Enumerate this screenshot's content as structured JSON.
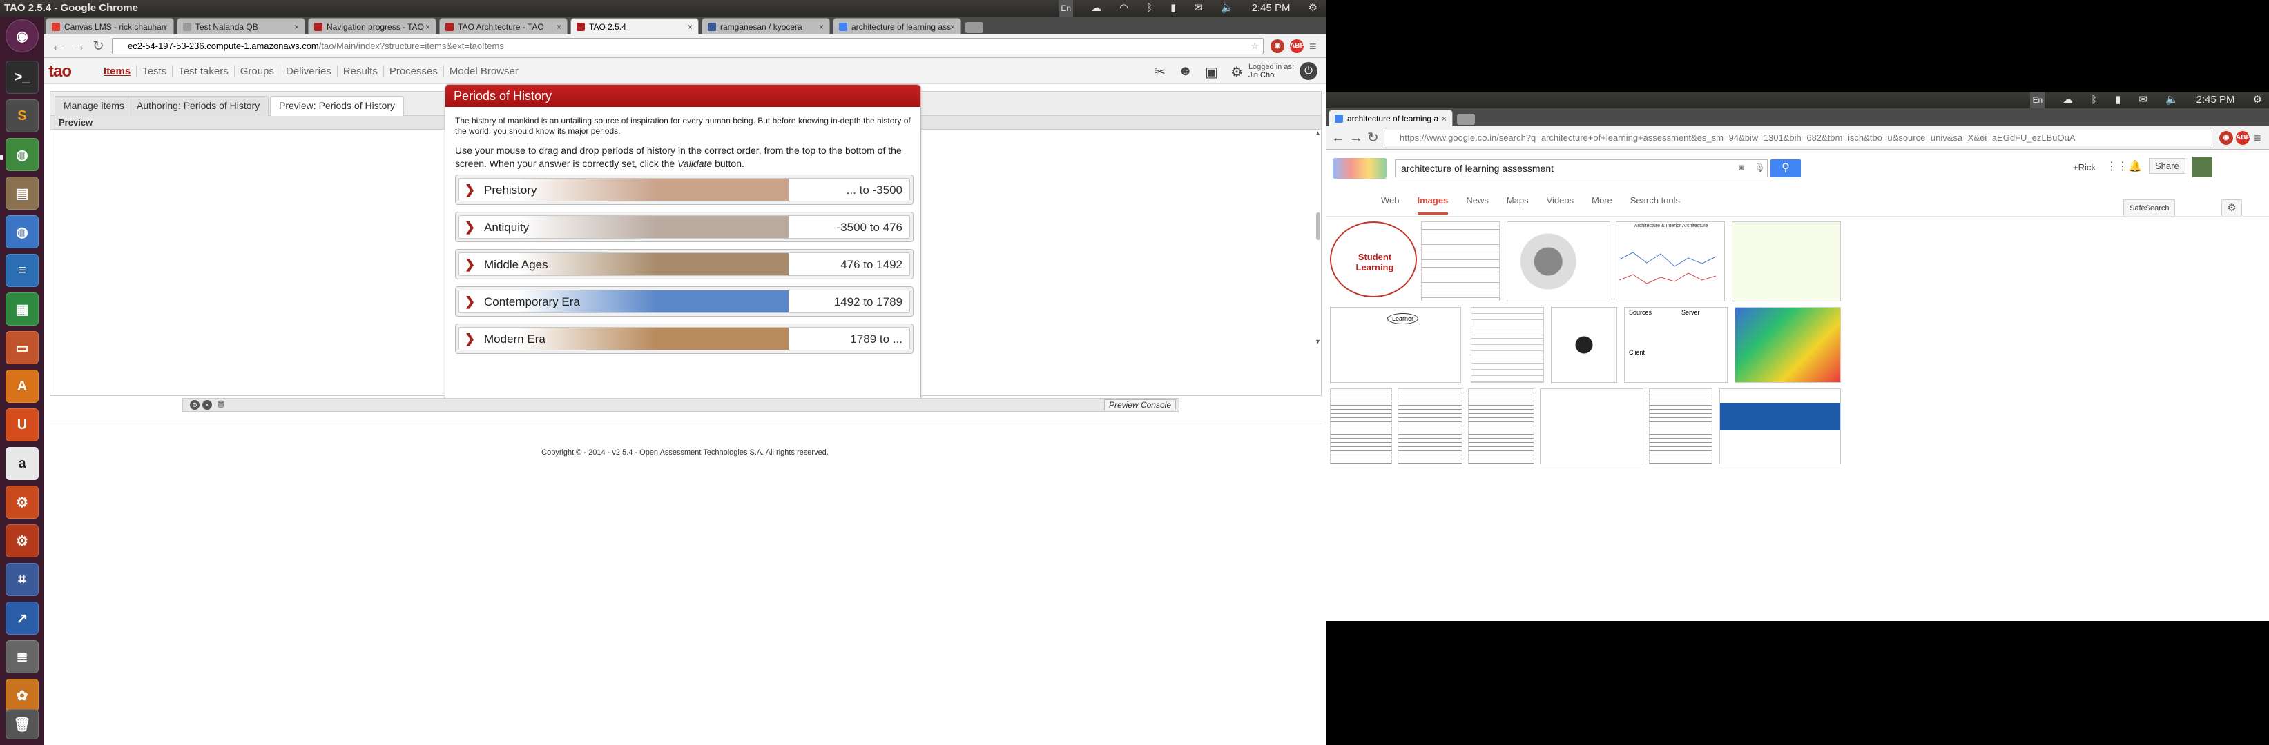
{
  "os": {
    "window_title": "TAO 2.5.4 - Google Chrome",
    "clock": "2:45 PM",
    "keyboard": "En",
    "launcher_icons": [
      "terminal-icon",
      "sublime-icon",
      "chrome-icon",
      "files-icon",
      "chromium-icon",
      "writer-icon",
      "calc-icon",
      "impress-icon",
      "software-center-icon",
      "ubuntu-one-icon",
      "amazon-icon",
      "settings-icon",
      "system-monitor-icon",
      "workspace-icon",
      "disk-icon",
      "photo-icon",
      "trash-icon"
    ]
  },
  "browser_left": {
    "tabs": [
      {
        "label": "Canvas LMS - rick.chauhan",
        "color": "#e33b2e"
      },
      {
        "label": "Test Nalanda QB",
        "color": "#999"
      },
      {
        "label": "Navigation progress - TAO",
        "color": "#b01e1e"
      },
      {
        "label": "TAO Architecture - TAO",
        "color": "#b01e1e"
      },
      {
        "label": "TAO 2.5.4",
        "color": "#b01e1e"
      },
      {
        "label": "ramganesan / kyocera",
        "color": "#3b5a99"
      },
      {
        "label": "architecture of learning ass",
        "color": "#4285f4"
      }
    ],
    "active_tab": 4,
    "url_host": "ec2-54-197-53-236.compute-1.amazonaws.com",
    "url_path": "/tao/Main/index?structure=items&ext=taoItems"
  },
  "tao": {
    "logo": "tao",
    "nav": [
      "Items",
      "Tests",
      "Test takers",
      "Groups",
      "Deliveries",
      "Results",
      "Processes",
      "Model Browser"
    ],
    "logged_in_label": "Logged in as:",
    "user": "Jin Choi",
    "tabs": [
      "Manage items",
      "Authoring: Periods of History",
      "Preview: Periods of History"
    ],
    "preview_label": "Preview",
    "console_label": "Preview Console",
    "footer": "Copyright © - 2014 - v2.5.4 - Open Assessment Technologies S.A. All rights reserved."
  },
  "item": {
    "title": "Periods of History",
    "intro": "The history of mankind is an unfailing source of inspiration for every human being. But before knowing in-depth the history of the world, you should know its major periods.",
    "instruction_pre": "Use your mouse to drag and drop periods of history in the correct order, from the top to the bottom of the screen. When your answer is correctly set, click the ",
    "instruction_em": "Validate",
    "instruction_post": " button.",
    "periods": [
      {
        "label": "Prehistory",
        "range": "... to -3500",
        "tint": "#c9a38a"
      },
      {
        "label": "Antiquity",
        "range": "-3500 to 476",
        "tint": "#b9aaa0"
      },
      {
        "label": "Middle Ages",
        "range": "476 to 1492",
        "tint": "#a88b6a"
      },
      {
        "label": "Contemporary Era",
        "range": "1492 to 1789",
        "tint": "#5a87c9"
      },
      {
        "label": "Modern Era",
        "range": "1789 to ...",
        "tint": "#b88a5c"
      }
    ]
  },
  "browser_right": {
    "tab": "architecture of learning a",
    "url": "https://www.google.co.in/search?q=architecture+of+learning+assessment&es_sm=94&biw=1301&bih=682&tbm=isch&tbo=u&source=univ&sa=X&ei=aEGdFU_ezLBuOuA",
    "query": "architecture of learning assessment",
    "user": "+Rick",
    "share": "Share",
    "tabs": [
      "Web",
      "Images",
      "News",
      "Maps",
      "Videos",
      "More",
      "Search tools"
    ],
    "active_tab": 1,
    "safesearch": "SafeSearch",
    "thumb_labels": [
      "Student Learning",
      "Learner",
      "Architecture & Interior Architecture",
      "Sources",
      "Server",
      "Client"
    ]
  }
}
